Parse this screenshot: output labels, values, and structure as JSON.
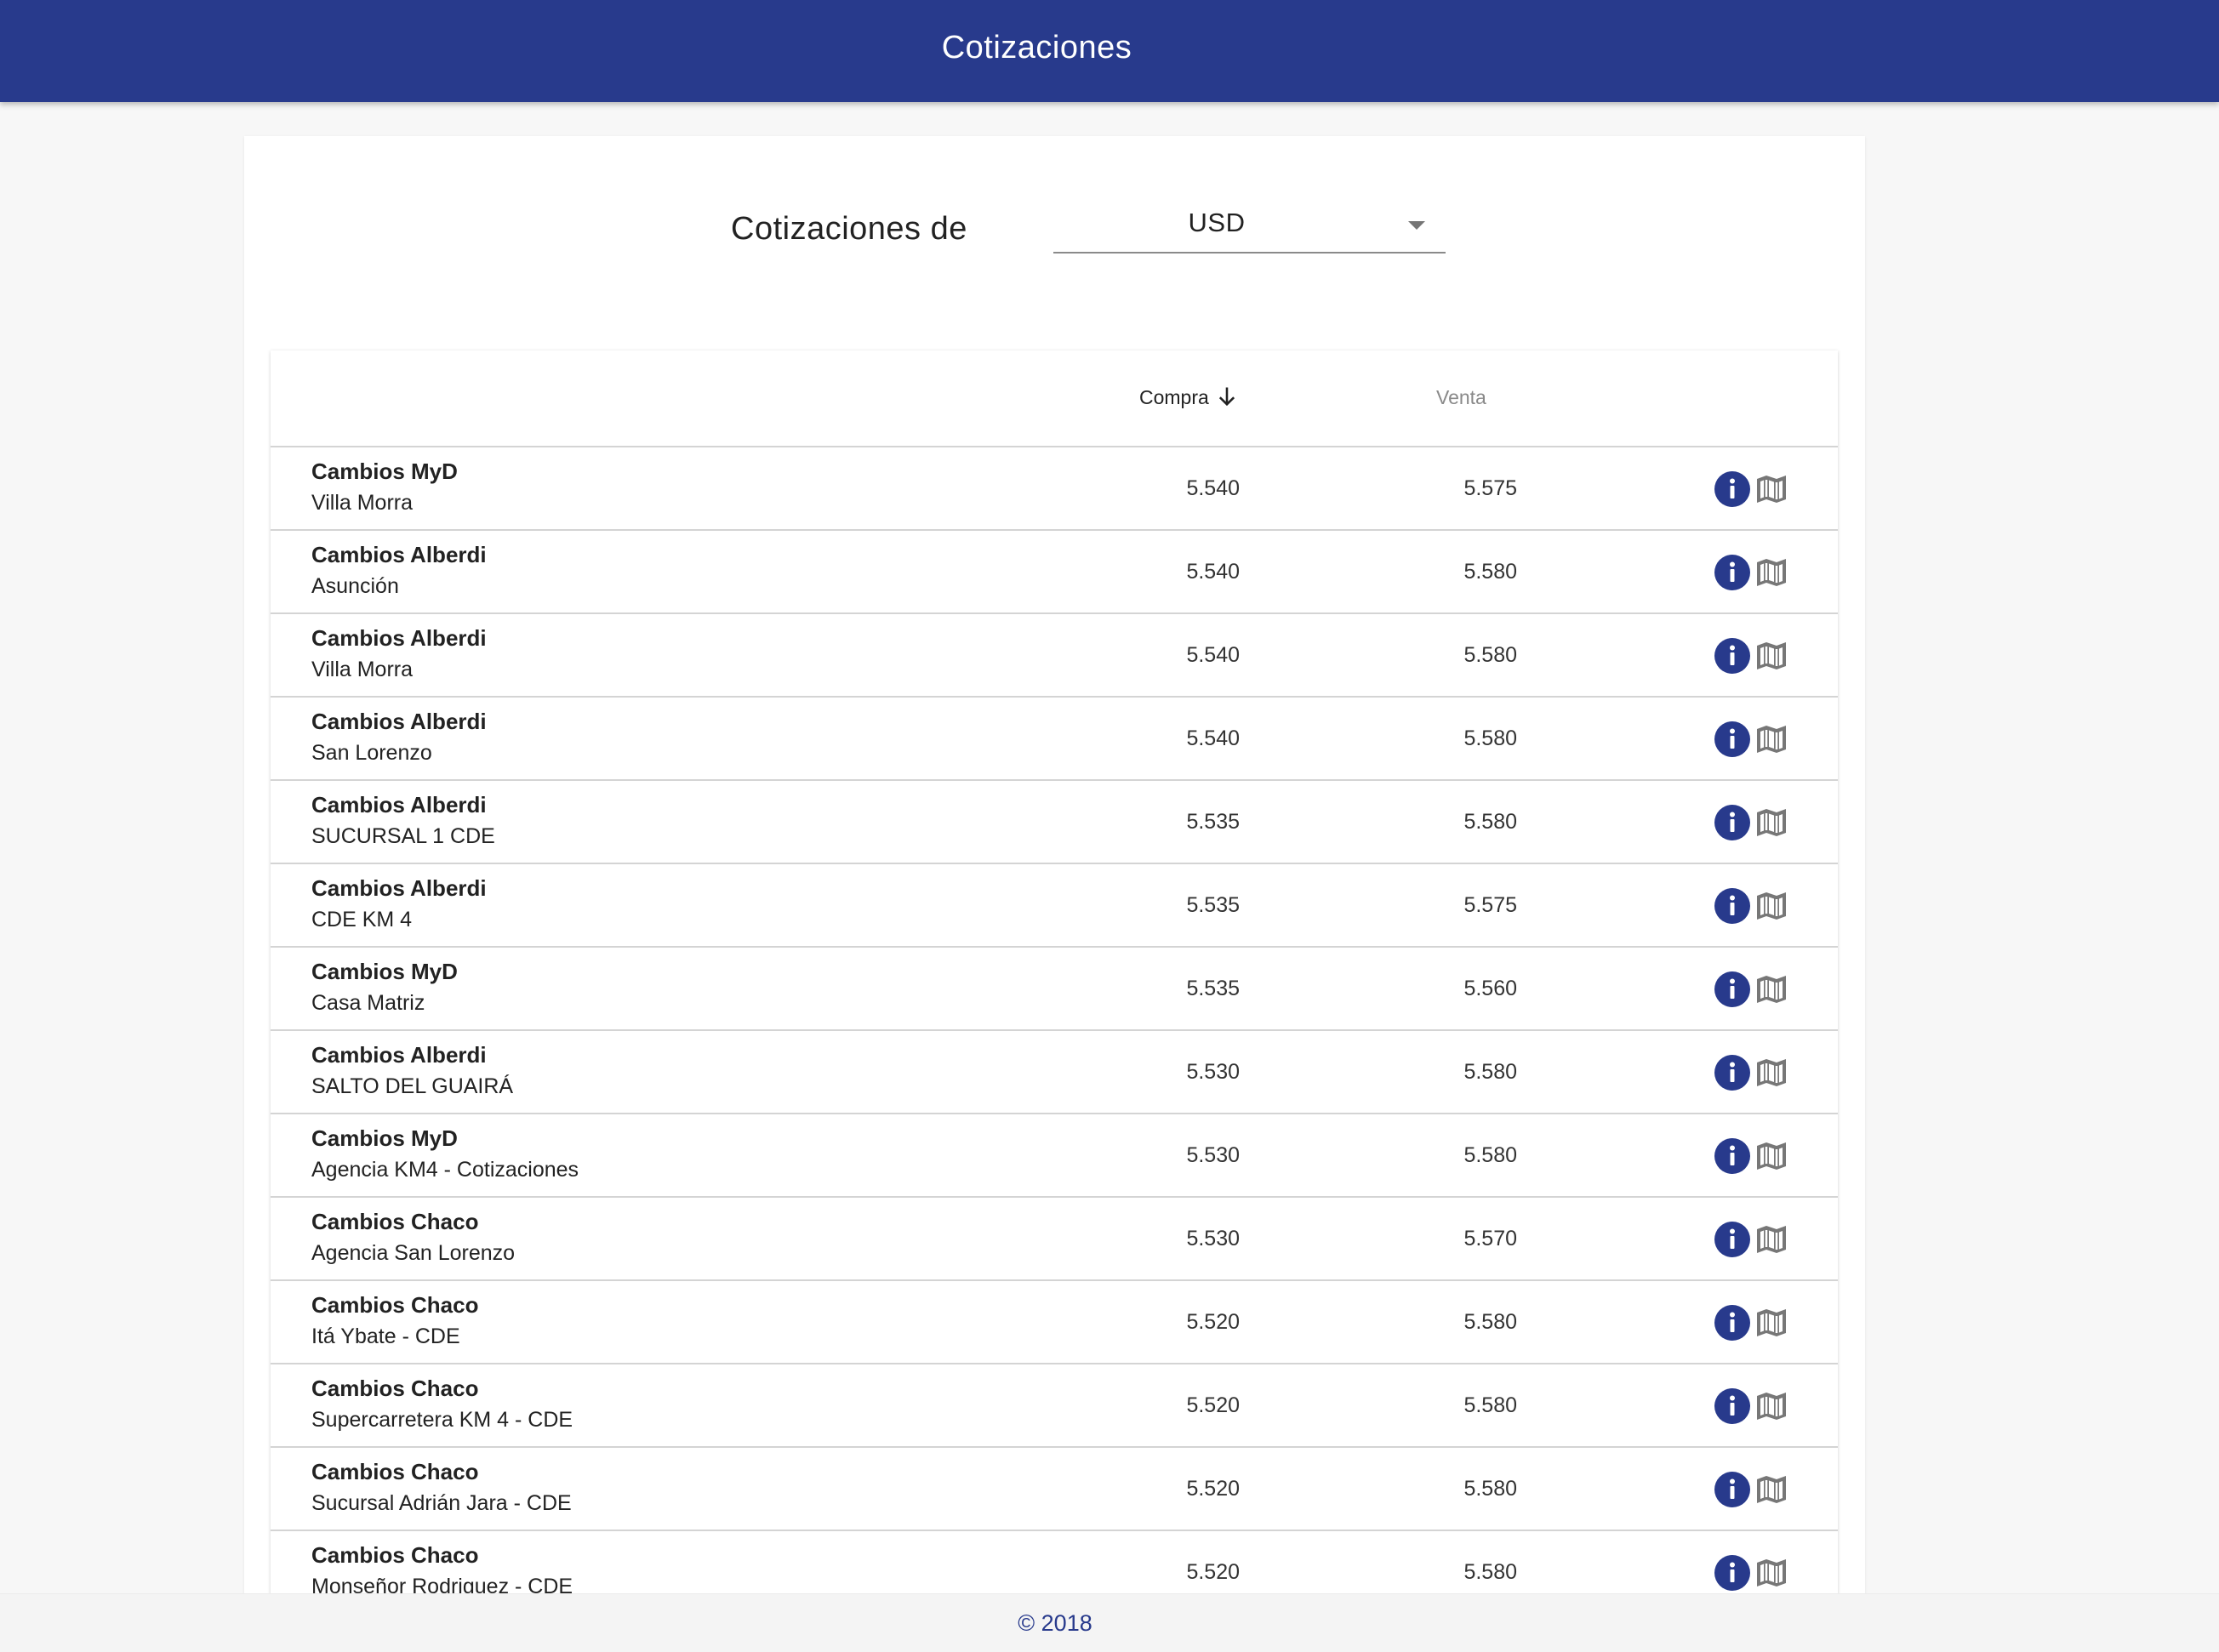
{
  "appbar": {
    "title": "Cotizaciones"
  },
  "selector": {
    "label": "Cotizaciones de",
    "value": "USD"
  },
  "table": {
    "headers": {
      "compra": "Compra",
      "venta": "Venta"
    },
    "sort": {
      "column": "compra",
      "direction": "desc"
    },
    "rows": [
      {
        "name": "Cambios MyD",
        "branch": "Villa Morra",
        "compra": "5.540",
        "venta": "5.575"
      },
      {
        "name": "Cambios Alberdi",
        "branch": "Asunción",
        "compra": "5.540",
        "venta": "5.580"
      },
      {
        "name": "Cambios Alberdi",
        "branch": "Villa Morra",
        "compra": "5.540",
        "venta": "5.580"
      },
      {
        "name": "Cambios Alberdi",
        "branch": "San Lorenzo",
        "compra": "5.540",
        "venta": "5.580"
      },
      {
        "name": "Cambios Alberdi",
        "branch": "SUCURSAL 1 CDE",
        "compra": "5.535",
        "venta": "5.580"
      },
      {
        "name": "Cambios Alberdi",
        "branch": "CDE KM 4",
        "compra": "5.535",
        "venta": "5.575"
      },
      {
        "name": "Cambios MyD",
        "branch": "Casa Matriz",
        "compra": "5.535",
        "venta": "5.560"
      },
      {
        "name": "Cambios Alberdi",
        "branch": "SALTO DEL GUAIRÁ",
        "compra": "5.530",
        "venta": "5.580"
      },
      {
        "name": "Cambios MyD",
        "branch": "Agencia KM4 - Cotizaciones",
        "compra": "5.530",
        "venta": "5.580"
      },
      {
        "name": "Cambios Chaco",
        "branch": "Agencia San Lorenzo",
        "compra": "5.530",
        "venta": "5.570"
      },
      {
        "name": "Cambios Chaco",
        "branch": "Itá Ybate - CDE",
        "compra": "5.520",
        "venta": "5.580"
      },
      {
        "name": "Cambios Chaco",
        "branch": "Supercarretera KM 4 - CDE",
        "compra": "5.520",
        "venta": "5.580"
      },
      {
        "name": "Cambios Chaco",
        "branch": "Sucursal Adrián Jara - CDE",
        "compra": "5.520",
        "venta": "5.580"
      },
      {
        "name": "Cambios Chaco",
        "branch": "Monseñor Rodriguez - CDE",
        "compra": "5.520",
        "venta": "5.580"
      }
    ]
  },
  "footer": {
    "text": "© 2018"
  },
  "icons": {
    "info": "info-circle-icon",
    "map": "map-icon",
    "sort": "arrow-down-icon",
    "dropdown": "caret-down-icon"
  },
  "colors": {
    "primary": "#283a8c",
    "map_icon": "#777777"
  }
}
